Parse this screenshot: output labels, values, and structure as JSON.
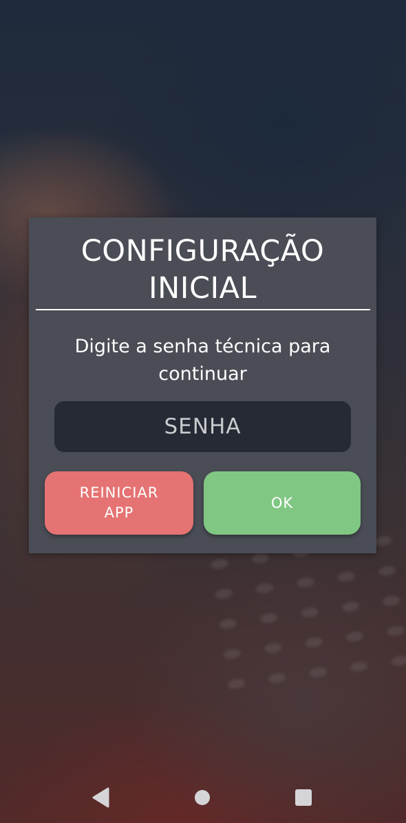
{
  "dialog": {
    "title_line1": "CONFIGURAÇÃO",
    "title_line2": "INICIAL",
    "message_line1": "Digite a senha técnica para",
    "message_line2": "continuar",
    "password": {
      "value": "",
      "placeholder": "SENHA"
    },
    "restart_button": {
      "label_line1": "REINICIAR",
      "label_line2": "APP",
      "color": "#e57373"
    },
    "ok_button": {
      "label": "OK",
      "color": "#81c784"
    }
  },
  "nav_bar": {
    "back_icon": "triangle-back-icon",
    "home_icon": "circle-home-icon",
    "recents_icon": "square-recents-icon",
    "icon_color": "#d5d5d8"
  }
}
